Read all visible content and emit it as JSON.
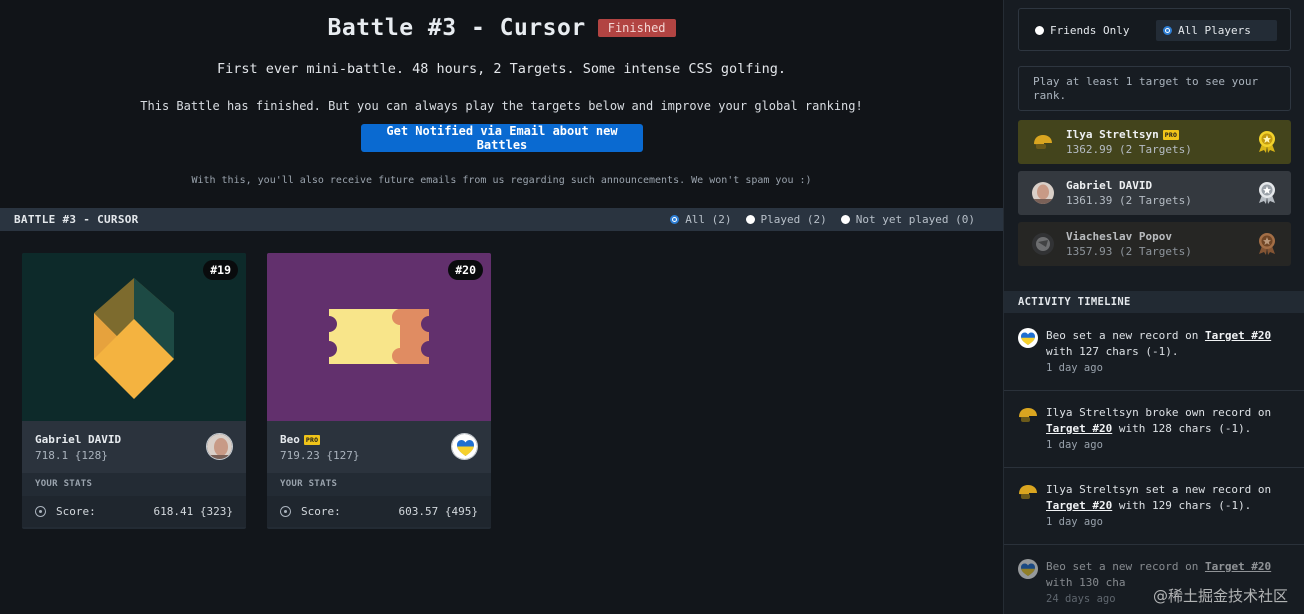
{
  "header": {
    "title": "Battle #3 - Cursor",
    "status_badge": "Finished",
    "subtitle": "First ever mini-battle. 48 hours, 2 Targets. Some intense CSS golfing.",
    "finished_note": "This Battle has finished. But you can always play the targets below and improve your global ranking!",
    "notify_button": "Get Notified via Email about new Battles",
    "spam_note": "With this, you'll also receive future emails from us regarding such announcements. We won't spam you :)"
  },
  "section": {
    "title": "BATTLE #3 - CURSOR",
    "filters": [
      {
        "label": "All (2)",
        "checked": true
      },
      {
        "label": "Played (2)",
        "checked": false
      },
      {
        "label": "Not yet played (0)",
        "checked": false
      }
    ]
  },
  "targets": [
    {
      "number": "#19",
      "holder_name": "Gabriel DAVID",
      "holder_pro": false,
      "holder_score": "718.1 {128}",
      "stats_label": "YOUR STATS",
      "score_label": "Score:",
      "score_value": "618.41 {323}"
    },
    {
      "number": "#20",
      "holder_name": "Beo",
      "holder_pro": true,
      "holder_score": "719.23 {127}",
      "stats_label": "YOUR STATS",
      "score_label": "Score:",
      "score_value": "603.57 {495}"
    }
  ],
  "sidebar": {
    "scope": {
      "friends_label": "Friends Only",
      "all_label": "All Players",
      "selected": "All Players"
    },
    "rank_note": "Play at least 1 target to see your rank.",
    "pro_label": "PRO",
    "leaderboard": [
      {
        "name": "Ilya Streltsyn",
        "pro": true,
        "score": "1362.99 (2 Targets)",
        "medal": "gold-medal-icon"
      },
      {
        "name": "Gabriel DAVID",
        "pro": false,
        "score": "1361.39 (2 Targets)",
        "medal": "silver-medal-icon"
      },
      {
        "name": "Viacheslav Popov",
        "pro": false,
        "score": "1357.93 (2 Targets)",
        "medal": "bronze-medal-icon"
      }
    ],
    "timeline_title": "ACTIVITY TIMELINE",
    "timeline": [
      {
        "pre": "Beo set a new record on ",
        "link": "Target #20",
        "post": " with 127 chars (-1).",
        "time": "1 day ago"
      },
      {
        "pre": "Ilya Streltsyn broke own record on ",
        "link": "Target #20",
        "post": " with 128 chars (-1).",
        "time": "1 day ago"
      },
      {
        "pre": "Ilya Streltsyn set a new record on ",
        "link": "Target #20",
        "post": " with 129 chars (-1).",
        "time": "1 day ago"
      },
      {
        "pre": "Beo set a new record on ",
        "link": "Target #20",
        "post": " with 130 cha",
        "time": "24 days ago"
      }
    ]
  },
  "watermark": "@稀土掘金技术社区",
  "colors": {
    "accent_button": "#0a6ad1",
    "finished_badge": "#b24442",
    "target19_bg": "#0d2a2a",
    "target20_bg": "#62306d",
    "gold_row": "#43441c"
  }
}
